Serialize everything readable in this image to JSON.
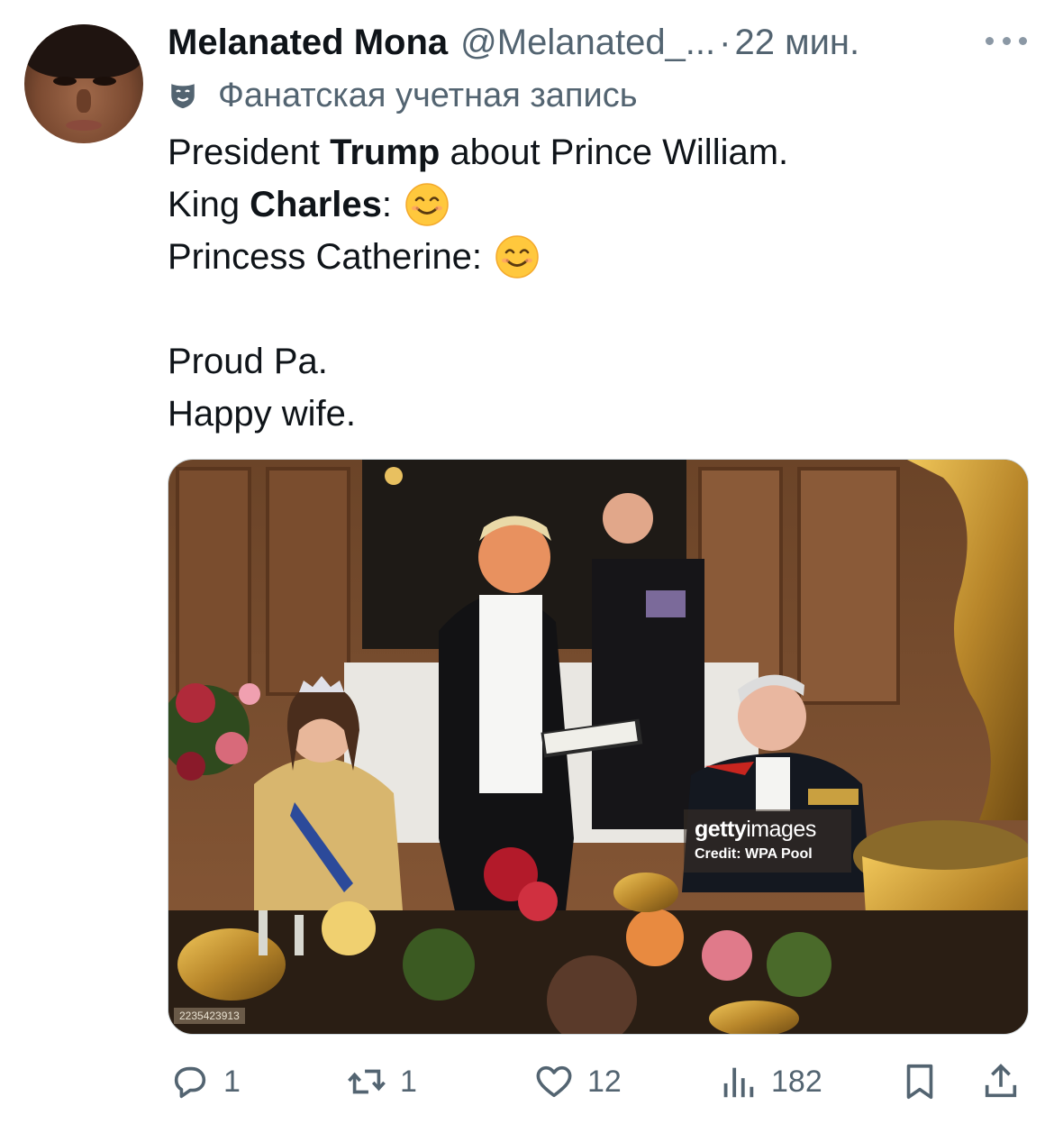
{
  "author": {
    "name": "Melanated Mona",
    "handle": "@Melanated_...",
    "separator": "·",
    "time": "22 мин."
  },
  "account_label": "Фанатская учетная запись",
  "tweet": {
    "line1_pre": "President ",
    "line1_bold": "Trump",
    "line1_post": " about Prince William.",
    "line2_pre": "King ",
    "line2_bold": "Charles",
    "line2_post": ":",
    "line3": "Princess Catherine:",
    "line4": "Proud Pa.",
    "line5": "Happy wife."
  },
  "media": {
    "watermark_brand_bold": "getty",
    "watermark_brand_light": "images",
    "watermark_credit": "Credit: WPA Pool",
    "image_id": "2235423913"
  },
  "actions": {
    "reply_count": "1",
    "retweet_count": "1",
    "like_count": "12",
    "view_count": "182"
  },
  "icons": {
    "more": "more-dots-icon",
    "account_label": "theater-mask-icon",
    "emoji": "smiling-face-emoji",
    "reply": "reply-icon",
    "retweet": "retweet-icon",
    "like": "heart-icon",
    "views": "views-chart-icon",
    "bookmark": "bookmark-icon",
    "share": "share-icon"
  },
  "colors": {
    "text": "#0f1419",
    "secondary": "#536471"
  }
}
